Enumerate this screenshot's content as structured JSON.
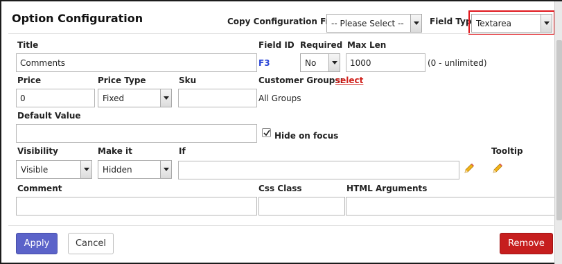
{
  "dialog": {
    "title": "Option Configuration"
  },
  "copy_config": {
    "label": "Copy Configuration From:",
    "value": "-- Please Select --"
  },
  "field_type": {
    "label": "Field Type",
    "value": "Textarea"
  },
  "row1": {
    "title_label": "Title",
    "title_value": "Comments",
    "field_id_label": "Field ID",
    "field_id_value": "F3",
    "required_label": "Required",
    "required_value": "No",
    "max_len_label": "Max Len",
    "max_len_value": "1000",
    "max_len_hint": "(0 - unlimited)"
  },
  "row2": {
    "price_label": "Price",
    "price_value": "0",
    "price_type_label": "Price Type",
    "price_type_value": "Fixed",
    "sku_label": "Sku",
    "sku_value": "",
    "customer_groups_label": "Customer Groups:",
    "customer_groups_link": "select",
    "customer_groups_value": "All Groups"
  },
  "row3": {
    "default_value_label": "Default Value",
    "default_value": "",
    "hide_on_focus_label": "Hide on focus",
    "hide_on_focus_checked": true
  },
  "row4": {
    "visibility_label": "Visibility",
    "visibility_value": "Visible",
    "make_it_label": "Make it",
    "make_it_value": "Hidden",
    "if_label": "If",
    "if_value": "",
    "tooltip_label": "Tooltip",
    "edit_icon": "pencil-icon"
  },
  "row5": {
    "comment_label": "Comment",
    "comment_value": "",
    "css_class_label": "Css Class",
    "css_class_value": "",
    "html_args_label": "HTML Arguments",
    "html_args_value": ""
  },
  "buttons": {
    "apply": "Apply",
    "cancel": "Cancel",
    "remove": "Remove"
  },
  "colors": {
    "apply": "#5b63c9",
    "remove": "#c61e1e",
    "highlight": "#e0171c",
    "link": "#d0211c",
    "field_id": "#2a45d6"
  }
}
